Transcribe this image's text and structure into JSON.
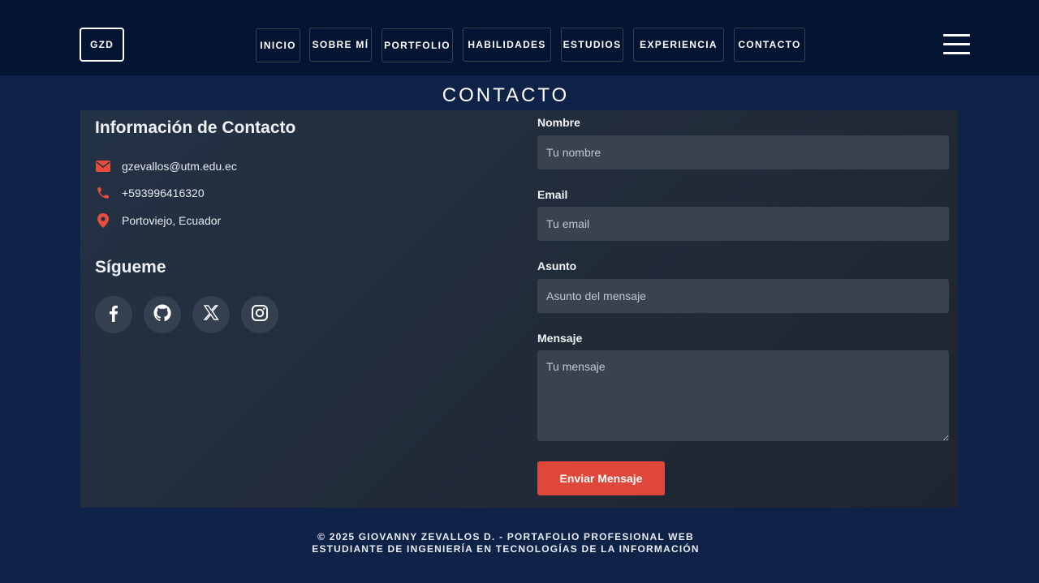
{
  "header": {
    "logo": "GZD",
    "nav": [
      "INICIO",
      "SOBRE MÍ",
      "PORTFOLIO",
      "HABILIDADES",
      "ESTUDIOS",
      "EXPERIENCIA",
      "CONTACTO"
    ],
    "menu_icon": "hamburger-icon"
  },
  "section": {
    "title": "CONTACTO"
  },
  "contact_info": {
    "title": "Información de Contacto",
    "items": [
      {
        "icon": "envelope-icon",
        "text": "gzevallos@utm.edu.ec"
      },
      {
        "icon": "phone-icon",
        "text": "+593996416320"
      },
      {
        "icon": "map-pin-icon",
        "text": "Portoviejo, Ecuador"
      }
    ],
    "follow_title": "Sígueme",
    "socials": [
      "facebook-icon",
      "github-icon",
      "x-icon",
      "instagram-icon"
    ]
  },
  "form": {
    "name_label": "Nombre",
    "name_placeholder": "Tu nombre",
    "email_label": "Email",
    "email_placeholder": "Tu email",
    "subject_label": "Asunto",
    "subject_placeholder": "Asunto del mensaje",
    "message_label": "Mensaje",
    "message_placeholder": "Tu mensaje",
    "submit_label": "Enviar Mensaje"
  },
  "footer": {
    "line1": "© 2025 GIOVANNY ZEVALLOS D. - PORTAFOLIO PROFESIONAL WEB",
    "line2": "ESTUDIANTE DE INGENIERÍA EN TECNOLOGÍAS DE LA INFORMACIÓN"
  },
  "colors": {
    "page_bg": "#0f2248",
    "header_bg": "#031533",
    "accent": "#e0473b",
    "icon_red": "#e74c3c"
  }
}
